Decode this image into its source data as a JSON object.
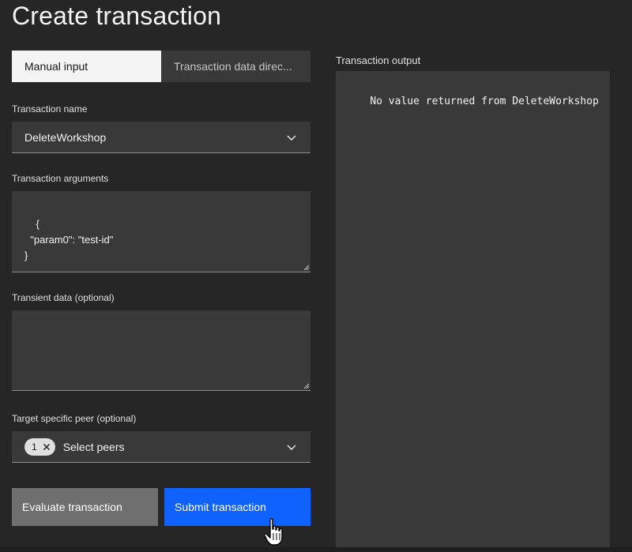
{
  "page": {
    "title": "Create transaction"
  },
  "tabs": [
    {
      "label": "Manual input",
      "active": true
    },
    {
      "label": "Transaction data direc...",
      "active": false
    }
  ],
  "form": {
    "transaction_name": {
      "label": "Transaction name",
      "value": "DeleteWorkshop"
    },
    "transaction_arguments": {
      "label": "Transaction arguments",
      "value": "{\n  \"param0\": \"test-id\"\n}"
    },
    "transient_data": {
      "label": "Transient data (optional)",
      "value": ""
    },
    "target_peer": {
      "label": "Target specific peer (optional)",
      "tag_count": "1",
      "placeholder": "Select peers"
    }
  },
  "buttons": {
    "evaluate": "Evaluate transaction",
    "submit": "Submit transaction"
  },
  "output": {
    "label": "Transaction output",
    "text": "No value returned from DeleteWorkshop"
  },
  "colors": {
    "background": "#262626",
    "field": "#393939",
    "primary": "#0f62fe",
    "secondary": "#6f6f6f"
  },
  "icons": [
    "chevron-down-icon",
    "close-icon",
    "resize-grip-icon",
    "hand-pointer-icon"
  ]
}
